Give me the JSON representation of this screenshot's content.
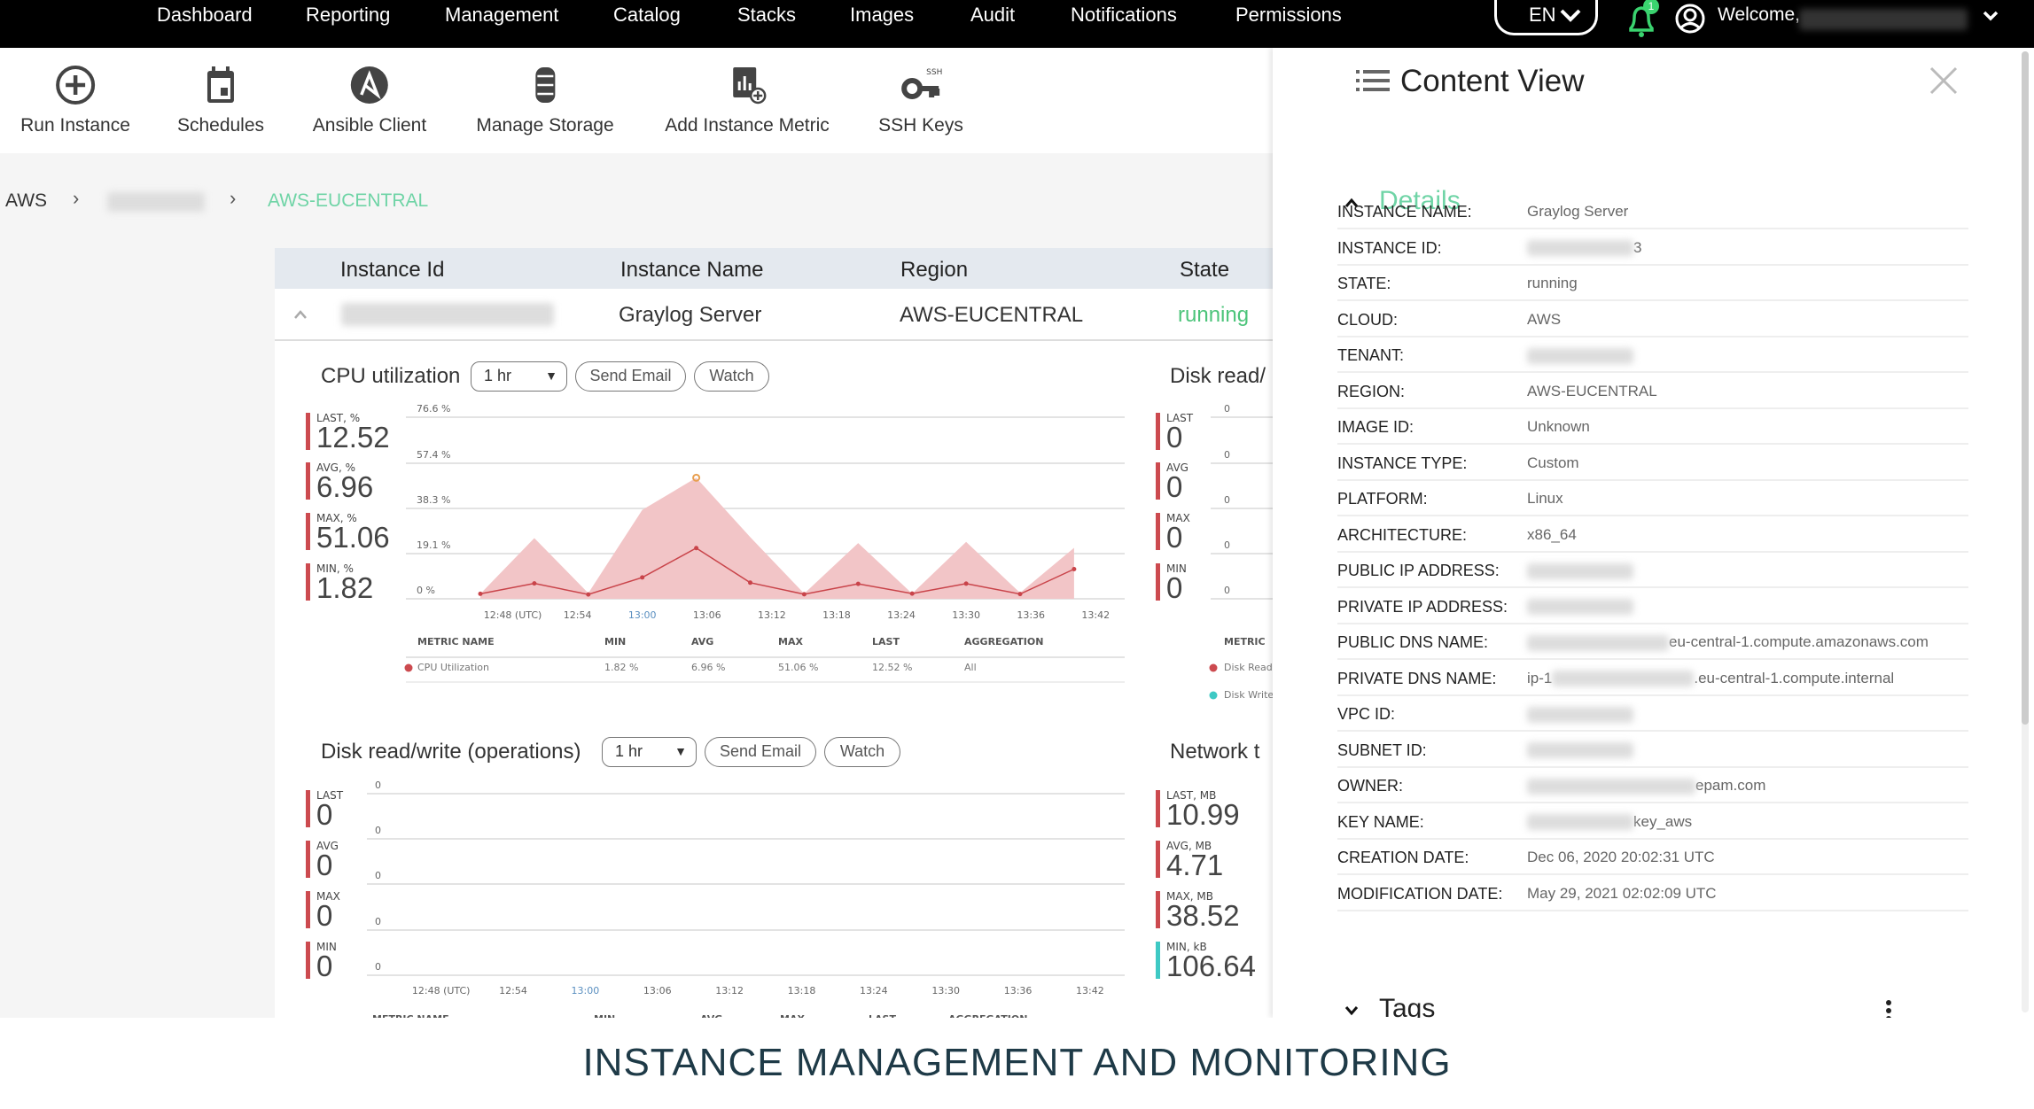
{
  "nav": {
    "items": [
      "Dashboard",
      "Reporting",
      "Management",
      "Catalog",
      "Stacks",
      "Images",
      "Audit",
      "Notifications",
      "Permissions"
    ],
    "language": "EN",
    "notification_count": "1",
    "welcome": "Welcome,"
  },
  "toolbar": {
    "items": [
      {
        "label": "Run Instance",
        "icon": "plus-circle-icon"
      },
      {
        "label": "Schedules",
        "icon": "calendar-icon"
      },
      {
        "label": "Ansible Client",
        "icon": "ansible-icon"
      },
      {
        "label": "Manage Storage",
        "icon": "database-icon"
      },
      {
        "label": "Add Instance Metric",
        "icon": "add-metric-icon"
      },
      {
        "label": "SSH Keys",
        "icon": "ssh-key-icon"
      }
    ]
  },
  "breadcrumb": {
    "root": "AWS",
    "current": "AWS-EUCENTRAL"
  },
  "table": {
    "headers": [
      "Instance Id",
      "Instance Name",
      "Region",
      "State"
    ],
    "row": {
      "name": "Graylog Server",
      "region": "AWS-EUCENTRAL",
      "state": "running"
    }
  },
  "controls": {
    "period": "1 hr",
    "send_email": "Send Email",
    "watch": "Watch"
  },
  "metrics_table": {
    "headers": [
      "METRIC NAME",
      "MIN",
      "AVG",
      "MAX",
      "LAST",
      "AGGREGATION"
    ],
    "cpu_row": [
      "CPU Utilization",
      "1.82 %",
      "6.96 %",
      "51.06 %",
      "12.52 %",
      "All"
    ],
    "disk_side_header": "METRIC",
    "disk_side_rows": [
      "Disk Read",
      "Disk Write"
    ]
  },
  "side_disk": {
    "title": "Disk read/",
    "stats": [
      {
        "label": "LAST",
        "value": "0"
      },
      {
        "label": "AVG",
        "value": "0"
      },
      {
        "label": "MAX",
        "value": "0"
      },
      {
        "label": "MIN",
        "value": "0"
      }
    ],
    "yticks": [
      "0",
      "0",
      "0",
      "0",
      "0"
    ]
  },
  "network": {
    "title": "Network t",
    "stats": [
      {
        "label": "LAST, MB",
        "value": "10.99"
      },
      {
        "label": "AVG, MB",
        "value": "4.71"
      },
      {
        "label": "MAX, MB",
        "value": "38.52"
      },
      {
        "label": "MIN, kB",
        "value": "106.64"
      }
    ]
  },
  "chart_data": [
    {
      "type": "area",
      "title": "CPU utilization",
      "stats": [
        {
          "label": "LAST, %",
          "value": "12.52"
        },
        {
          "label": "AVG, %",
          "value": "6.96"
        },
        {
          "label": "MAX, %",
          "value": "51.06"
        },
        {
          "label": "MIN, %",
          "value": "1.82"
        }
      ],
      "yticks": [
        "0 %",
        "19.1 %",
        "38.3 %",
        "57.4 %",
        "76.6 %"
      ],
      "ylim": [
        0,
        76.6
      ],
      "xticks": [
        "12:48 (UTC)",
        "12:54",
        "13:00",
        "13:06",
        "13:12",
        "13:18",
        "13:24",
        "13:30",
        "13:36",
        "13:42"
      ],
      "x": [
        "12:45",
        "12:50",
        "12:55",
        "13:00",
        "13:05",
        "13:10",
        "13:15",
        "13:20",
        "13:25",
        "13:30",
        "13:35",
        "13:40"
      ],
      "series": [
        {
          "name": "CPU Utilization",
          "kind": "max-area",
          "values": [
            2.1,
            25.6,
            2.4,
            37.5,
            51.06,
            26,
            2.2,
            23.5,
            2.2,
            24,
            2.5,
            21.5
          ]
        },
        {
          "name": "CPU Utilization",
          "kind": "avg-line",
          "values": [
            2.1,
            6.5,
            1.82,
            9.0,
            21.4,
            6.8,
            1.9,
            6.3,
            2.2,
            6.4,
            2.0,
            12.52
          ]
        }
      ],
      "colors": {
        "area": "#f2c5c7",
        "line": "#c9444a",
        "max_marker": "#e8a050"
      }
    },
    {
      "type": "line",
      "title": "Disk read/write (operations)",
      "stats": [
        {
          "label": "LAST",
          "value": "0"
        },
        {
          "label": "AVG",
          "value": "0"
        },
        {
          "label": "MAX",
          "value": "0"
        },
        {
          "label": "MIN",
          "value": "0"
        }
      ],
      "yticks": [
        "0",
        "0",
        "0",
        "0",
        "0"
      ],
      "xticks": [
        "12:48 (UTC)",
        "12:54",
        "13:00",
        "13:06",
        "13:12",
        "13:18",
        "13:24",
        "13:30",
        "13:36",
        "13:42"
      ],
      "series": []
    }
  ],
  "panel": {
    "title": "Content View",
    "details_label": "Details",
    "tags_label": "Tags",
    "rows": [
      {
        "key": "INSTANCE NAME:",
        "value": "Graylog Server"
      },
      {
        "key": "INSTANCE ID:",
        "blur": true,
        "suffix": "3"
      },
      {
        "key": "STATE:",
        "value": "running"
      },
      {
        "key": "CLOUD:",
        "value": "AWS"
      },
      {
        "key": "TENANT:",
        "blur": true
      },
      {
        "key": "REGION:",
        "value": "AWS-EUCENTRAL"
      },
      {
        "key": "IMAGE ID:",
        "value": "Unknown"
      },
      {
        "key": "INSTANCE TYPE:",
        "value": "Custom"
      },
      {
        "key": "PLATFORM:",
        "value": "Linux"
      },
      {
        "key": "ARCHITECTURE:",
        "value": "x86_64"
      },
      {
        "key": "PUBLIC IP ADDRESS:",
        "blur": true
      },
      {
        "key": "PRIVATE IP ADDRESS:",
        "blur": true
      },
      {
        "key": "PUBLIC DNS NAME:",
        "blur": true,
        "suffix": "eu-central-1.compute.amazonaws.com"
      },
      {
        "key": "PRIVATE DNS NAME:",
        "prefix": "ip-1",
        "blur": true,
        "suffix": ".eu-central-1.compute.internal"
      },
      {
        "key": "VPC ID:",
        "blur": true
      },
      {
        "key": "SUBNET ID:",
        "blur": true
      },
      {
        "key": "OWNER:",
        "blur": true,
        "suffix": "epam.com"
      },
      {
        "key": "KEY NAME:",
        "blur": true,
        "suffix": "key_aws"
      },
      {
        "key": "CREATION DATE:",
        "value": "Dec 06, 2020 20:02:31 UTC"
      },
      {
        "key": "MODIFICATION DATE:",
        "value": "May 29, 2021 02:02:09 UTC"
      }
    ]
  },
  "caption": "INSTANCE MANAGEMENT AND MONITORING",
  "colors": {
    "accent_green": "#5fcf97",
    "stat_red": "#cc4a4f",
    "stat_teal": "#3ec9c4",
    "topbar": "#000000"
  }
}
